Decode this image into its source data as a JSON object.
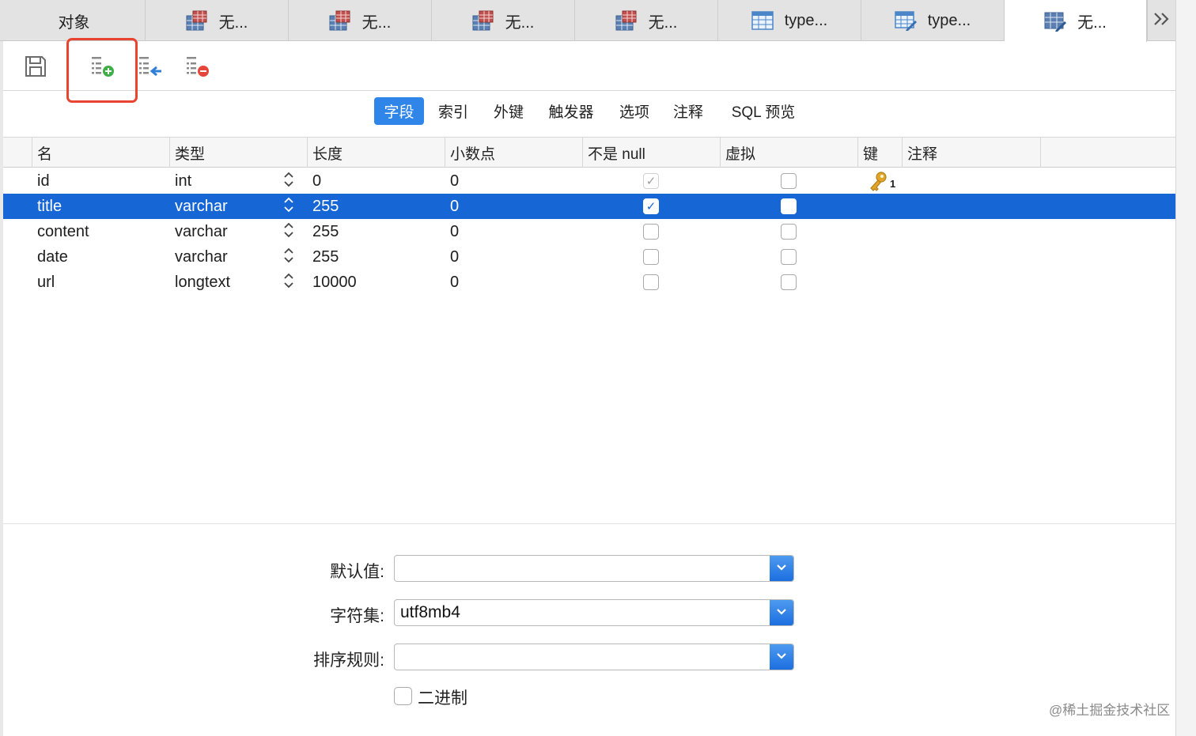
{
  "tabs": [
    {
      "label": "对象",
      "icon": "none",
      "active": false
    },
    {
      "label": "无...",
      "icon": "table-icon",
      "active": false
    },
    {
      "label": "无...",
      "icon": "table-icon",
      "active": false
    },
    {
      "label": "无...",
      "icon": "table-icon",
      "active": false
    },
    {
      "label": "无...",
      "icon": "table-icon",
      "active": false
    },
    {
      "label": "type...",
      "icon": "grid-icon",
      "active": false
    },
    {
      "label": "type...",
      "icon": "edit-grid-icon",
      "active": false
    },
    {
      "label": "无...",
      "icon": "edit-table-icon",
      "active": true
    }
  ],
  "toolbar": {
    "items": [
      "save-icon",
      "add-field-icon",
      "insert-field-icon",
      "delete-field-icon"
    ],
    "highlight_color": "#e8442f"
  },
  "subtabs": [
    "字段",
    "索引",
    "外键",
    "触发器",
    "选项",
    "注释",
    "SQL 预览"
  ],
  "columns": [
    "名",
    "类型",
    "长度",
    "小数点",
    "不是 null",
    "虚拟",
    "键",
    "注释"
  ],
  "rows": [
    {
      "name": "id",
      "type": "int",
      "length": "0",
      "decimals": "0",
      "not_null": true,
      "not_null_dim": true,
      "virtual": false,
      "key": "1",
      "selected": false
    },
    {
      "name": "title",
      "type": "varchar",
      "length": "255",
      "decimals": "0",
      "not_null": true,
      "not_null_dim": false,
      "virtual": false,
      "key": "",
      "selected": true
    },
    {
      "name": "content",
      "type": "varchar",
      "length": "255",
      "decimals": "0",
      "not_null": false,
      "not_null_dim": false,
      "virtual": false,
      "key": "",
      "selected": false
    },
    {
      "name": "date",
      "type": "varchar",
      "length": "255",
      "decimals": "0",
      "not_null": false,
      "not_null_dim": false,
      "virtual": false,
      "key": "",
      "selected": false
    },
    {
      "name": "url",
      "type": "longtext",
      "length": "10000",
      "decimals": "0",
      "not_null": false,
      "not_null_dim": false,
      "virtual": false,
      "key": "",
      "selected": false
    }
  ],
  "form": {
    "default_label": "默认值:",
    "default_value": "",
    "charset_label": "字符集:",
    "charset_value": "utf8mb4",
    "collation_label": "排序规则:",
    "collation_value": "",
    "binary_label": "二进制",
    "binary_checked": false
  },
  "watermark": "@稀土掘金技术社区",
  "colors": {
    "accent": "#2f86e8",
    "selection": "#1666d6",
    "key": "#e2a52a"
  }
}
